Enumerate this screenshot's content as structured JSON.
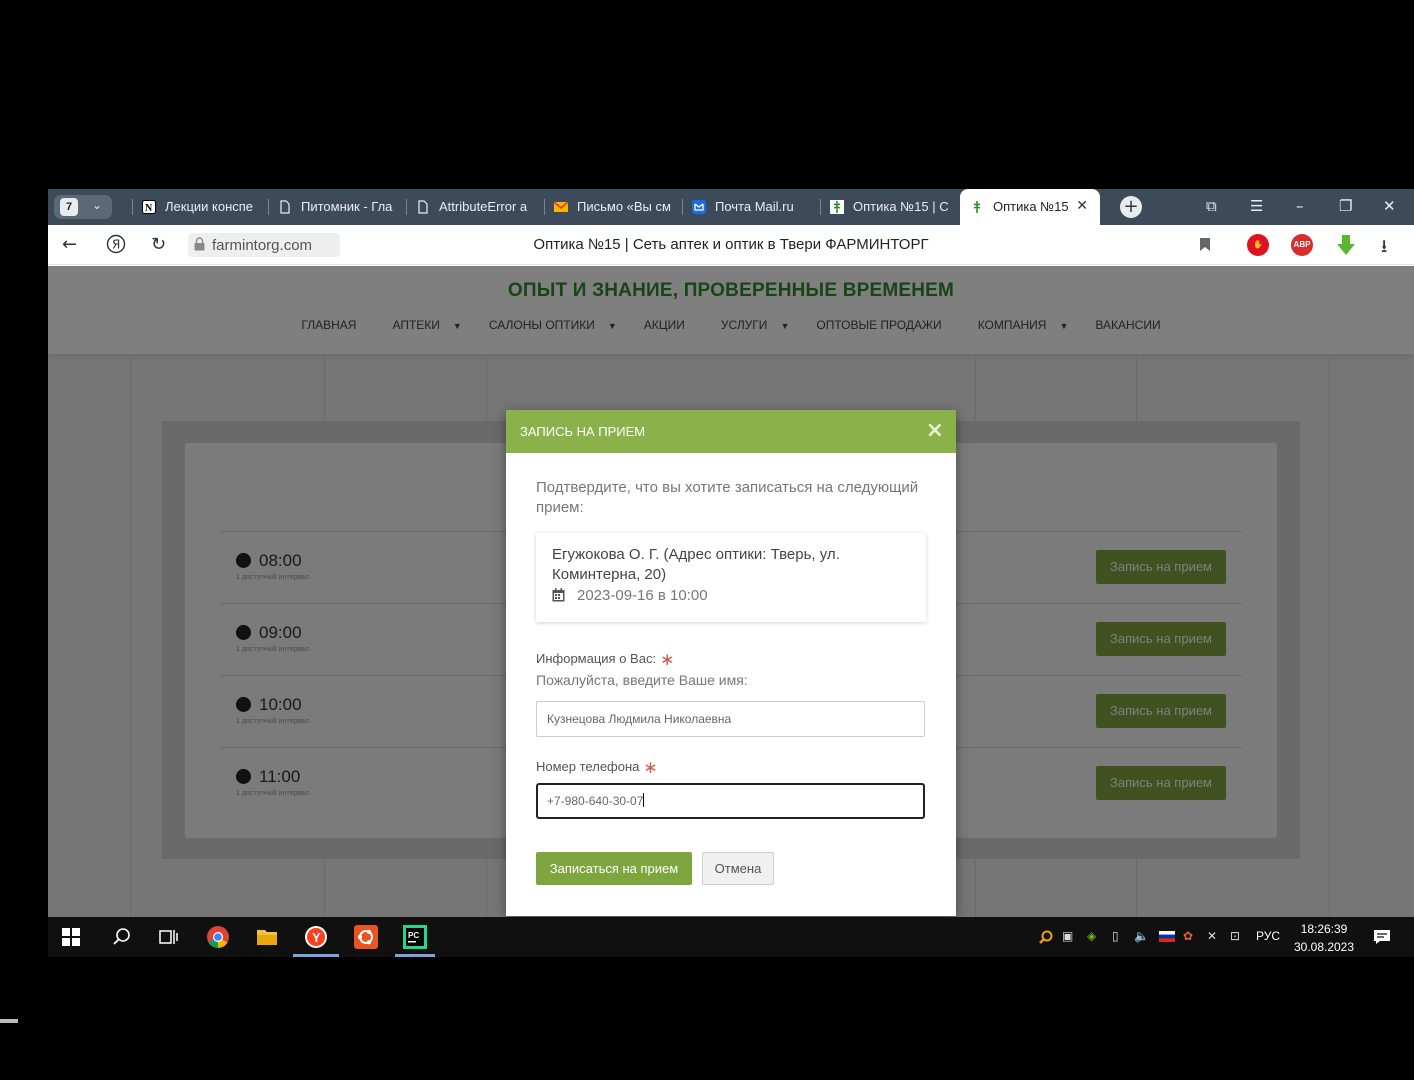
{
  "browser": {
    "tab_counter": "7",
    "tabs": [
      {
        "label": "Лекции конспе",
        "icon": "notion-icon"
      },
      {
        "label": "Питомник - Гла",
        "icon": "document-icon"
      },
      {
        "label": "AttributeError a",
        "icon": "document-icon"
      },
      {
        "label": "Письмо «Вы см",
        "icon": "mail-icon"
      },
      {
        "label": "Почта Mail.ru",
        "icon": "mailru-icon"
      },
      {
        "label": "Оптика №15 | С",
        "icon": "pharmacy-icon"
      },
      {
        "label": "Оптика №15",
        "icon": "pharmacy-icon"
      }
    ],
    "url": "farmintorg.com",
    "page_title": "Оптика №15 | Сеть аптек и оптик в Твери ФАРМИНТОРГ",
    "ext_abp_label": "ABP"
  },
  "site": {
    "slogan": "ОПЫТ И ЗНАНИЕ, ПРОВЕРЕННЫЕ ВРЕМЕНЕМ",
    "menu": [
      {
        "label": "ГЛАВНАЯ",
        "dropdown": false
      },
      {
        "label": "АПТЕКИ",
        "dropdown": true
      },
      {
        "label": "САЛОНЫ ОПТИКИ",
        "dropdown": true
      },
      {
        "label": "АКЦИИ",
        "dropdown": false
      },
      {
        "label": "УСЛУГИ",
        "dropdown": true
      },
      {
        "label": "ОПТОВЫЕ ПРОДАЖИ",
        "dropdown": false
      },
      {
        "label": "КОМПАНИЯ",
        "dropdown": true
      },
      {
        "label": "ВАКАНСИИ",
        "dropdown": false
      }
    ],
    "slots": [
      {
        "time": "08:00",
        "sub": "1 доступный интервал",
        "button": "Запись на прием"
      },
      {
        "time": "09:00",
        "sub": "1 доступный интервал",
        "button": "Запись на прием"
      },
      {
        "time": "10:00",
        "sub": "1 доступный интервал",
        "button": "Запись на прием"
      },
      {
        "time": "11:00",
        "sub": "1 доступный интервал",
        "button": "Запись на прием"
      }
    ]
  },
  "modal": {
    "title": "ЗАПИСЬ НА ПРИЕМ",
    "close": "×",
    "intro": "Подтвердите, что вы хотите записаться на следующий прием:",
    "appointment_name": "Егужокова О. Г. (Адрес оптики: Тверь, ул. Коминтерна, 20)",
    "appointment_date": "2023-09-16 в 10:00",
    "info_label": "Информация о Вас:",
    "info_hint": "Пожалуйста, введите Ваше имя:",
    "name_value": "Кузнецова Людмила Николаевна",
    "phone_label": "Номер телефона",
    "phone_value": "+7-980-640-30-07",
    "required_mark": "∗",
    "submit_label": "Записаться на прием",
    "cancel_label": "Отмена"
  },
  "taskbar": {
    "lang": "РУС",
    "time": "18:26:39",
    "date": "30.08.2023"
  },
  "colors": {
    "brand_green": "#8bb14a",
    "button_green": "#7fa53f",
    "slogan_green": "#2f8a2a",
    "tabbar": "#3c4a5a"
  }
}
